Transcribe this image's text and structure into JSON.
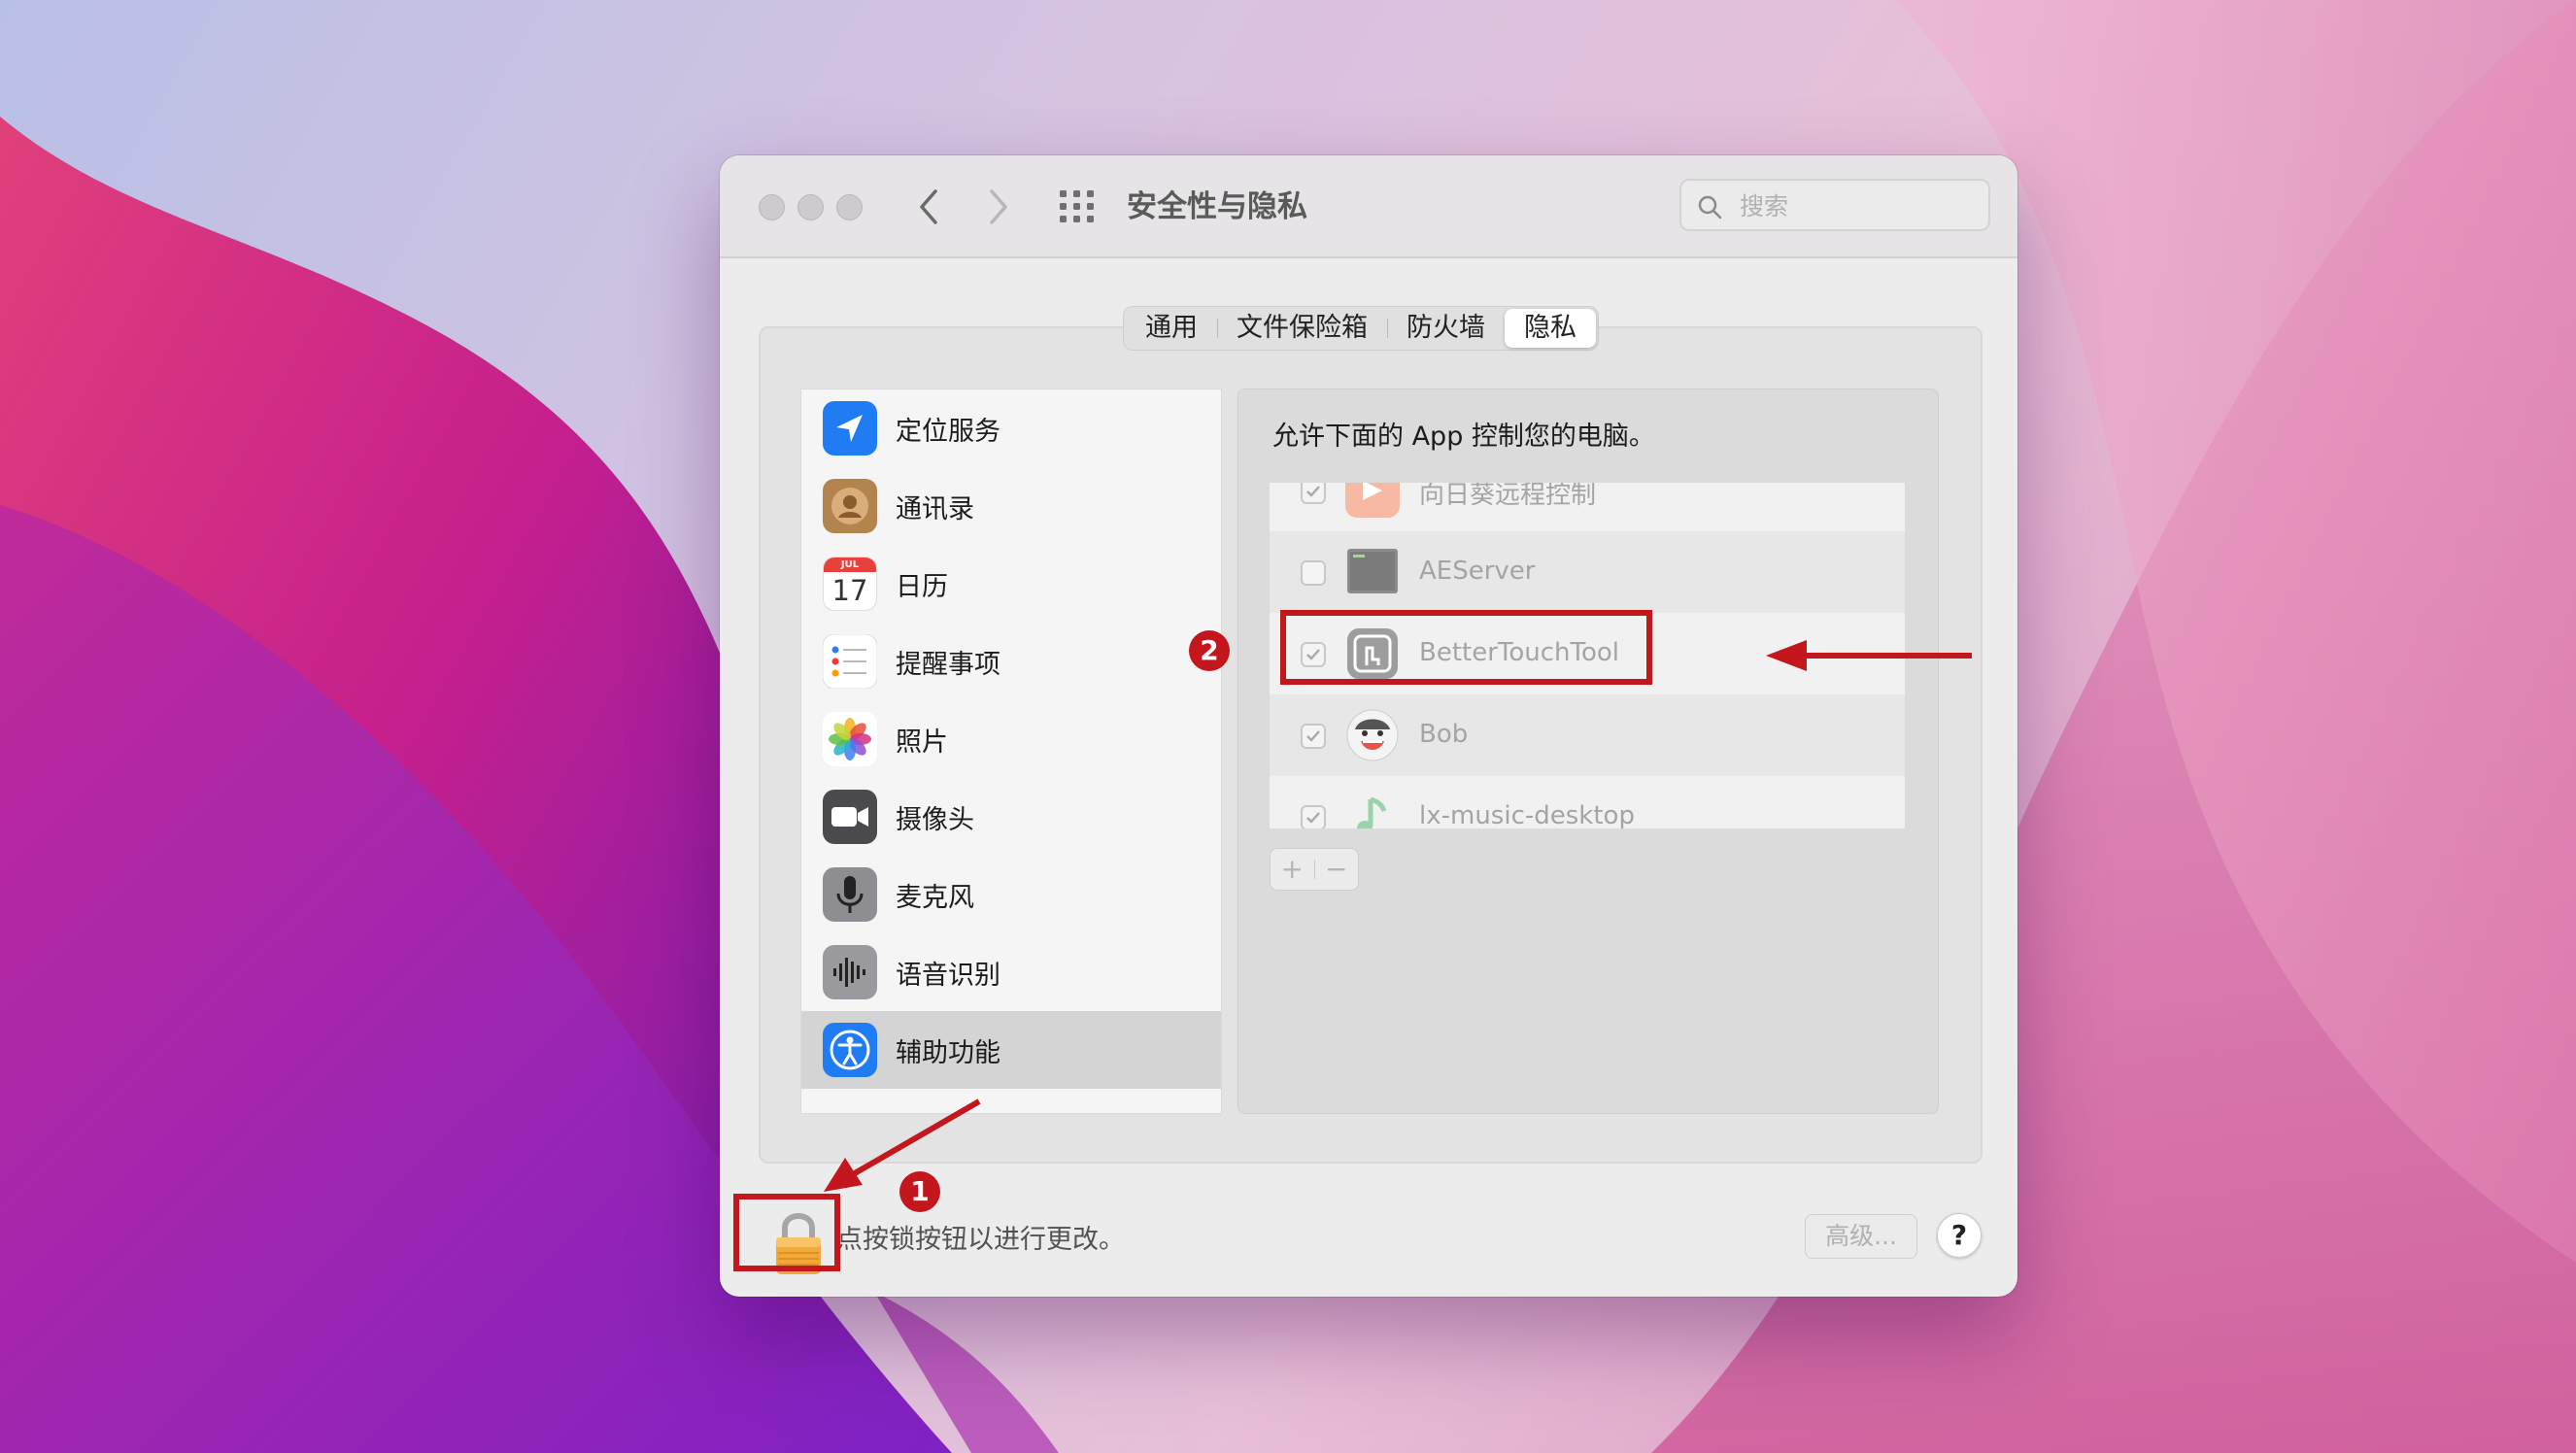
{
  "window": {
    "title": "安全性与隐私",
    "search_placeholder": "搜索"
  },
  "tabs": [
    {
      "label": "通用",
      "active": false
    },
    {
      "label": "文件保险箱",
      "active": false
    },
    {
      "label": "防火墙",
      "active": false
    },
    {
      "label": "隐私",
      "active": true
    }
  ],
  "sidebar": {
    "items": [
      {
        "label": "定位服务",
        "icon": "location-icon"
      },
      {
        "label": "通讯录",
        "icon": "contacts-icon"
      },
      {
        "label": "日历",
        "icon": "calendar-icon",
        "month": "JUL",
        "day": "17"
      },
      {
        "label": "提醒事项",
        "icon": "reminders-icon"
      },
      {
        "label": "照片",
        "icon": "photos-icon"
      },
      {
        "label": "摄像头",
        "icon": "camera-icon"
      },
      {
        "label": "麦克风",
        "icon": "microphone-icon"
      },
      {
        "label": "语音识别",
        "icon": "speech-recognition-icon"
      },
      {
        "label": "辅助功能",
        "icon": "accessibility-icon",
        "selected": true
      }
    ]
  },
  "detail": {
    "header": "允许下面的 App 控制您的电脑。",
    "apps": [
      {
        "name": "向日葵远程控制",
        "checked": true
      },
      {
        "name": "AEServer",
        "checked": false
      },
      {
        "name": "BetterTouchTool",
        "checked": true
      },
      {
        "name": "Bob",
        "checked": true
      },
      {
        "name": "lx-music-desktop",
        "checked": true
      }
    ],
    "add_label": "+",
    "remove_label": "−"
  },
  "footer": {
    "lock_text": "点按锁按钮以进行更改。",
    "advanced_label": "高级...",
    "help_label": "?"
  },
  "annotations": {
    "badge1": "1",
    "badge2": "2",
    "color": "#c4171d"
  }
}
